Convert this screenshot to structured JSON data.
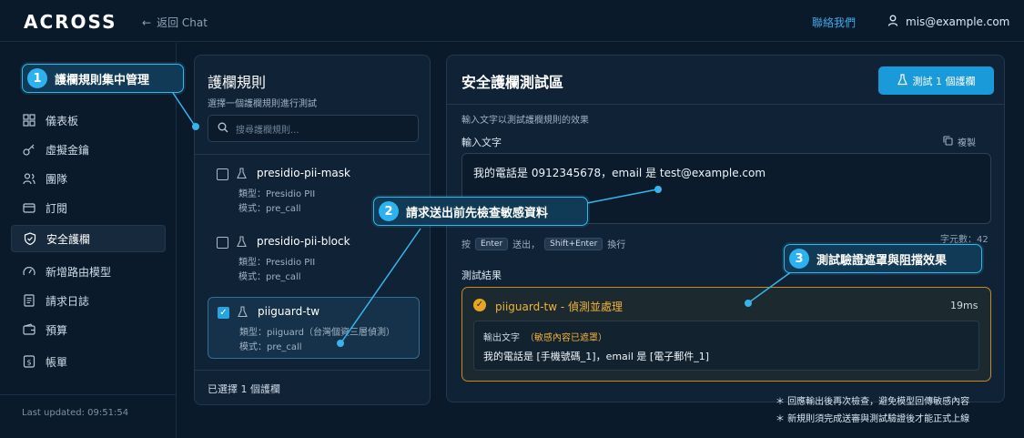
{
  "header": {
    "logo": "ACROSS",
    "back_label": "返回 Chat",
    "contact": "聯絡我們",
    "user_email": "mis@example.com"
  },
  "sidebar": {
    "items": [
      {
        "label": "儀表板",
        "icon": "dashboard-icon"
      },
      {
        "label": "虛擬金鑰",
        "icon": "key-icon"
      },
      {
        "label": "團隊",
        "icon": "team-icon"
      },
      {
        "label": "訂閱",
        "icon": "card-icon"
      },
      {
        "label": "安全護欄",
        "icon": "shield-icon",
        "active": true
      },
      {
        "label": "新增路由模型",
        "icon": "gauge-icon"
      },
      {
        "label": "請求日誌",
        "icon": "document-icon"
      },
      {
        "label": "預算",
        "icon": "wallet-icon"
      },
      {
        "label": "帳單",
        "icon": "dollar-icon"
      }
    ],
    "last_updated": "Last updated: 09:51:54"
  },
  "rules_panel": {
    "title": "護欄規則",
    "subtitle": "選擇一個護欄規則進行測試",
    "search_placeholder": "搜尋護欄規則...",
    "rules": [
      {
        "name": "presidio-pii-mask",
        "type": "類型：Presidio PII",
        "mode": "模式：pre_call",
        "checked": false
      },
      {
        "name": "presidio-pii-block",
        "type": "類型：Presidio PII",
        "mode": "模式：pre_call",
        "checked": false
      },
      {
        "name": "piiguard-tw",
        "type": "類型：piiguard（台灣個資三層偵測）",
        "mode": "模式：pre_call",
        "checked": true
      }
    ],
    "selected_count": "已選擇 1 個護欄"
  },
  "test_panel": {
    "title": "安全護欄測試區",
    "test_button": "測試 1 個護欄",
    "subtitle": "輸入文字以測試護欄規則的效果",
    "input_label": "輸入文字",
    "copy_label": "複製",
    "input_value": "我的電話是 0912345678，email 是 test@example.com",
    "char_count": "字元數：42",
    "hint": {
      "press": "按",
      "key1": "Enter",
      "send": "送出，",
      "key2": "Shift+Enter",
      "newline": "換行"
    },
    "results_label": "測試結果",
    "result": {
      "title": "piiguard-tw - 偵測並處理",
      "time": "19ms",
      "output_label": "輸出文字",
      "masked_note": "（敏感內容已遮罩）",
      "output_text": "我的電話是 [手機號碼_1]，email 是 [電子郵件_1]"
    }
  },
  "footnotes": [
    "＊ 回應輸出後再次檢查，避免模型回傳敏感內容",
    "＊ 新規則須完成送審與測試驗證後才能正式上線"
  ],
  "callouts": [
    {
      "number": "1",
      "text": "護欄規則集中管理"
    },
    {
      "number": "2",
      "text": "請求送出前先檢查敏感資料"
    },
    {
      "number": "3",
      "text": "測試驗證遮罩與阻擋效果"
    }
  ],
  "colors": {
    "accent": "#1a9ad8",
    "warning": "#e6a623",
    "background": "#0b1a2b"
  }
}
